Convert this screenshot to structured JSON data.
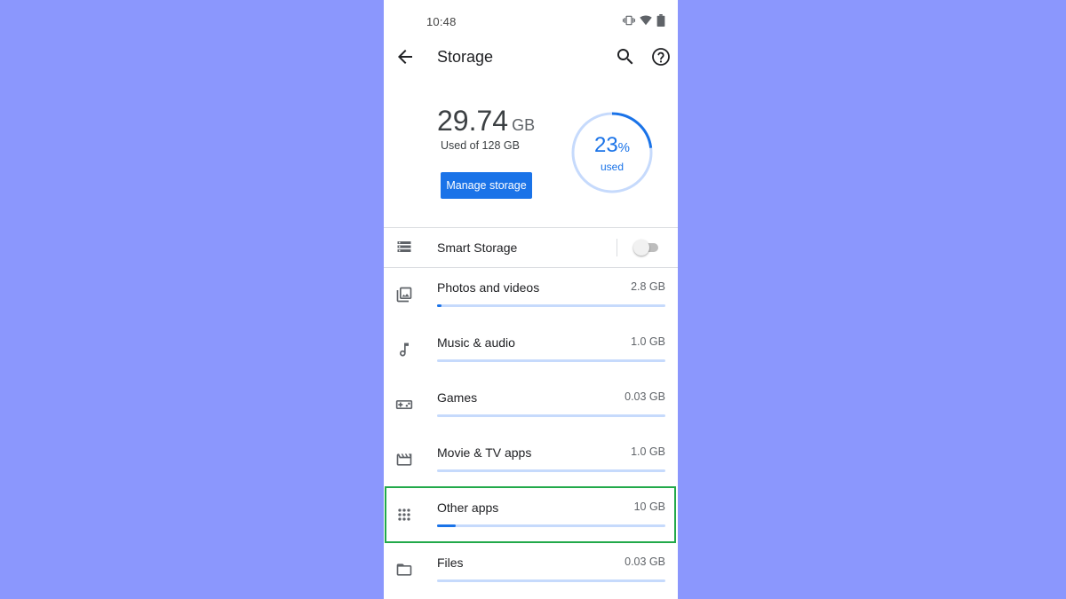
{
  "status_bar": {
    "time": "10:48"
  },
  "header": {
    "title": "Storage"
  },
  "summary": {
    "used_value": "29.74",
    "used_unit": "GB",
    "used_of": "Used of 128 GB",
    "percent": "23",
    "percent_sign": "%",
    "used_label": "used",
    "percent_fraction": 0.23,
    "manage_label": "Manage storage"
  },
  "smart_storage": {
    "label": "Smart Storage",
    "enabled": false
  },
  "categories": [
    {
      "label": "Photos and videos",
      "size": "2.8 GB",
      "fill_fraction": 0.02,
      "icon": "photos-icon"
    },
    {
      "label": "Music & audio",
      "size": "1.0 GB",
      "fill_fraction": 0.0,
      "icon": "music-note-icon"
    },
    {
      "label": "Games",
      "size": "0.03 GB",
      "fill_fraction": 0.0,
      "icon": "gamepad-icon"
    },
    {
      "label": "Movie & TV apps",
      "size": "1.0 GB",
      "fill_fraction": 0.0,
      "icon": "movie-icon"
    },
    {
      "label": "Other apps",
      "size": "10 GB",
      "fill_fraction": 0.08,
      "icon": "apps-grid-icon"
    },
    {
      "label": "Files",
      "size": "0.03 GB",
      "fill_fraction": 0.0,
      "icon": "folder-icon"
    }
  ],
  "colors": {
    "background": "#8b97fd",
    "accent": "#1a73e8",
    "track": "#c6dafc",
    "highlight": "#22a94a"
  }
}
